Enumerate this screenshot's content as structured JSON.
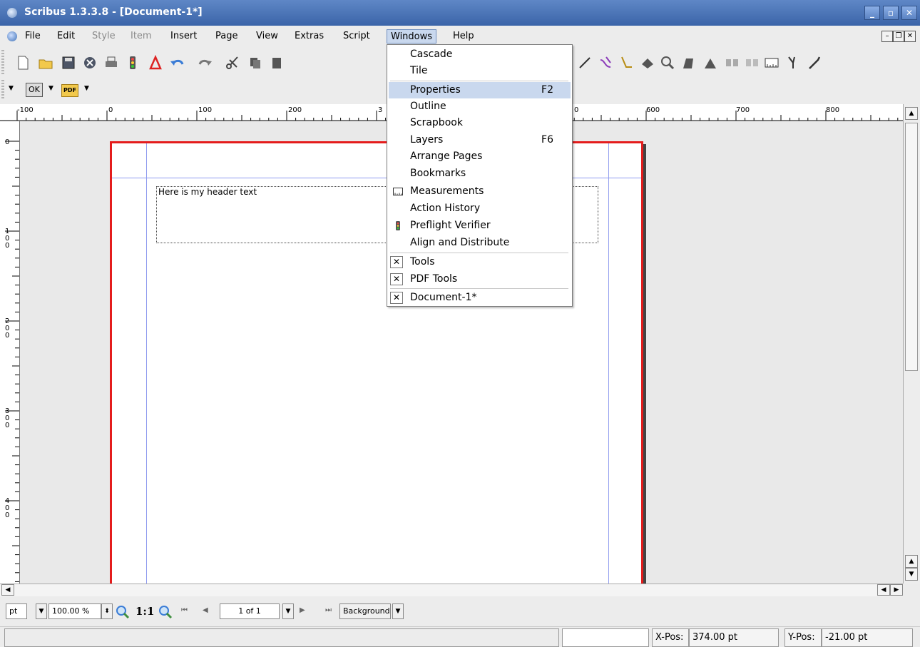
{
  "window": {
    "title": "Scribus 1.3.3.8 - [Document-1*]"
  },
  "menubar": [
    "File",
    "Edit",
    "Style",
    "Item",
    "Insert",
    "Page",
    "View",
    "Extras",
    "Script",
    "Windows",
    "Help"
  ],
  "windows_menu": {
    "cascade": "Cascade",
    "tile": "Tile",
    "properties": "Properties",
    "properties_shortcut": "F2",
    "outline": "Outline",
    "scrapbook": "Scrapbook",
    "layers": "Layers",
    "layers_shortcut": "F6",
    "arrange_pages": "Arrange Pages",
    "bookmarks": "Bookmarks",
    "measurements": "Measurements",
    "action_history": "Action History",
    "preflight_verifier": "Preflight Verifier",
    "align_distribute": "Align and Distribute",
    "tools": "Tools",
    "pdf_tools": "PDF Tools",
    "document": "Document-1*",
    "check_mark": "✕"
  },
  "toolbar2": {
    "ok": "OK",
    "pdf": "PDF"
  },
  "ruler": {
    "h_labels": [
      "-100",
      "0",
      "100",
      "200",
      "3",
      "0",
      "600",
      "700",
      "800"
    ],
    "v_labels": [
      "0",
      "1\n0\n0",
      "2\n0\n0",
      "3\n0\n0",
      "4\n0\n0"
    ]
  },
  "document": {
    "header_text": "Here is my header text"
  },
  "zoombar": {
    "unit": "pt",
    "zoom": "100.00 %",
    "one_to_one": "1:1",
    "page": "1 of 1",
    "layer": "Background"
  },
  "statusbar": {
    "x_label": "X-Pos:",
    "x_value": "374.00 pt",
    "y_label": "Y-Pos:",
    "y_value": "-21.00 pt"
  }
}
